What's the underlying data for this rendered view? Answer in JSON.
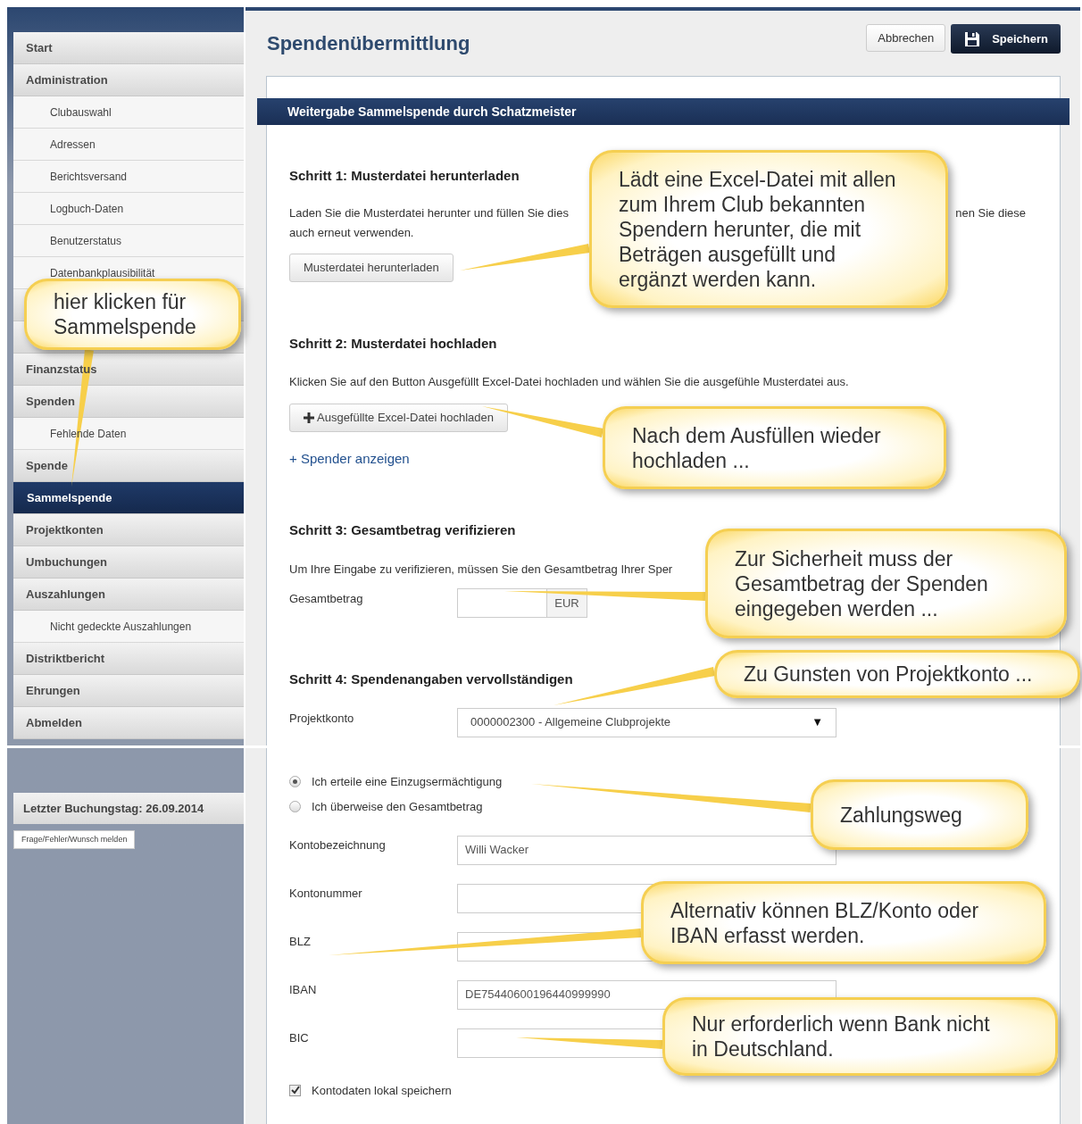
{
  "sidebar": {
    "items": [
      {
        "label": "Start",
        "selected": false
      },
      {
        "label": "Administration",
        "selected": false,
        "children": [
          {
            "label": "Clubauswahl",
            "selected": false
          },
          {
            "label": "Adressen",
            "selected": false
          },
          {
            "label": "Berichtsversand",
            "selected": false
          },
          {
            "label": "Logbuch-Daten",
            "selected": false
          },
          {
            "label": "Benutzerstatus",
            "selected": false
          },
          {
            "label": "Datenbankplausibilität",
            "selected": false
          }
        ]
      },
      {
        "label": "Finanzstatus",
        "selected": false
      },
      {
        "label": "Spenden",
        "selected": false,
        "children": [
          {
            "label": "Fehlende Daten",
            "selected": false
          }
        ]
      },
      {
        "label": "Spende",
        "selected": false
      },
      {
        "label": "Sammelspende",
        "selected": true
      },
      {
        "label": "Projektkonten",
        "selected": false
      },
      {
        "label": "Umbuchungen",
        "selected": false
      },
      {
        "label": "Auszahlungen",
        "selected": false,
        "children": [
          {
            "label": "Nicht gedeckte Auszahlungen",
            "selected": false
          }
        ]
      },
      {
        "label": "Distriktbericht",
        "selected": false
      },
      {
        "label": "Ehrungen",
        "selected": false
      },
      {
        "label": "Abmelden",
        "selected": false
      }
    ]
  },
  "sidebar_footer": {
    "last_booking": "Letzter Buchungstag: 26.09.2014",
    "report_button": "Frage/Fehler/Wunsch melden"
  },
  "page": {
    "title": "Spendenübermittlung",
    "buttons": [
      {
        "label": "Abbrechen",
        "kind": "default"
      },
      {
        "label": "Speichern",
        "kind": "primary"
      }
    ]
  },
  "panel": {
    "title": "Weitergabe Sammelspende durch Schatzmeister",
    "step1": {
      "heading": "Schritt 1: Musterdatei herunterladen",
      "text_left": "Laden Sie die Musterdatei herunter und füllen Sie dies",
      "text_right": "nen Sie diese",
      "text_line2": "auch erneut verwenden.",
      "button": "Musterdatei herunterladen"
    },
    "step2": {
      "heading": "Schritt 2: Musterdatei hochladen",
      "text": "Klicken Sie auf den Button Ausgefüllt Excel-Datei hochladen und wählen Sie die ausgefühle Musterdatei aus.",
      "button": "Ausgefüllte Excel-Datei hochladen",
      "link": "+ Spender anzeigen"
    },
    "step3": {
      "heading": "Schritt 3: Gesamtbetrag verifizieren",
      "text": "Um Ihre Eingabe zu verifizieren, müssen Sie den Gesamtbetrag Ihrer Sper",
      "label": "Gesamtbetrag",
      "unit": "EUR"
    },
    "step4": {
      "heading": "Schritt 4: Spendenangaben vervollständigen",
      "label": "Projektkonto",
      "value": "0000002300 - Allgemeine Clubprojekte",
      "caret": "▼"
    },
    "payment_options": [
      {
        "label": "Ich erteile eine Einzugsermächtigung",
        "selected": true
      },
      {
        "label": "Ich überweise den Gesamtbetrag",
        "selected": false
      }
    ],
    "fields": [
      {
        "label": "Kontobezeichnung",
        "value": "Willi Wacker"
      },
      {
        "label": "Kontonummer"
      },
      {
        "label": "BLZ"
      },
      {
        "label": "IBAN",
        "value": "DE75440600196440999990"
      },
      {
        "label": "BIC"
      }
    ],
    "save_locally": {
      "label": "Kontodaten lokal speichern",
      "checked": true
    }
  },
  "callouts": [
    {
      "text": "hier klicken für Sammelspende"
    },
    {
      "text": "Lädt eine Excel-Datei mit allen zum Ihrem Club bekannten Spendern herunter, die mit Beträgen ausgefüllt und ergänzt werden kann."
    },
    {
      "text": "Nach dem Ausfüllen wieder hochladen ..."
    },
    {
      "text": "Zur Sicherheit muss der Gesamtbetrag der Spenden eingegeben werden ..."
    },
    {
      "text": "Zu Gunsten von Projektkonto ..."
    },
    {
      "text": "Zahlungsweg"
    },
    {
      "text": "Alternativ können BLZ/Konto oder IBAN erfasst werden."
    },
    {
      "text": "Nur erforderlich wenn Bank nicht in Deutschland."
    }
  ]
}
